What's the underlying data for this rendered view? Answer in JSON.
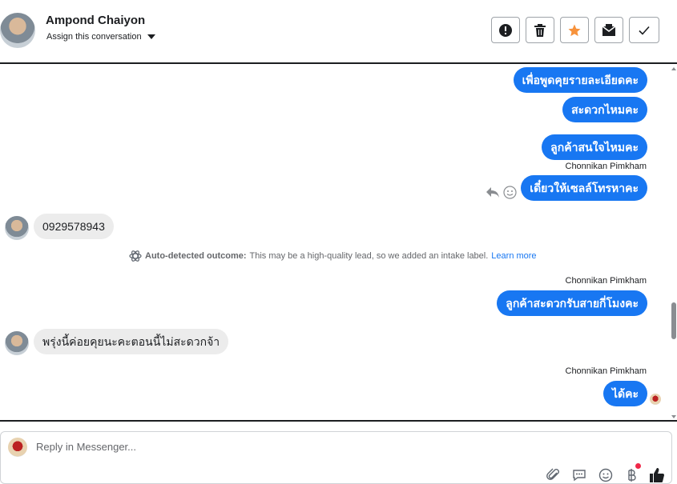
{
  "header": {
    "contact_name": "Ampond Chaiyon",
    "assign_label": "Assign this conversation",
    "actions": [
      "spam-icon",
      "trash-icon",
      "star-icon",
      "inbox-icon",
      "check-icon"
    ]
  },
  "messages": [
    {
      "dir": "out",
      "text": "เพื่อพูดคุยรายละเอียดคะ"
    },
    {
      "dir": "out",
      "text": "สะดวกไหมคะ"
    },
    {
      "dir": "out",
      "text": "ลูกค้าสนใจไหมคะ"
    },
    {
      "dir": "out",
      "sender": "Chonnikan Pimkham",
      "text": "เดี๋ยวให้เซลล์โทรหาคะ"
    },
    {
      "dir": "in",
      "text": "0929578943"
    },
    {
      "dir": "out",
      "sender": "Chonnikan Pimkham",
      "text": "ลูกค้าสะดวกรับสายกี่โมงคะ"
    },
    {
      "dir": "in",
      "text": "พรุ่งนี้ค่อยคุยนะคะตอนนี้ไม่สะดวกจ้า"
    },
    {
      "dir": "out",
      "sender": "Chonnikan Pimkham",
      "text": "ได้คะ"
    }
  ],
  "outcome": {
    "label": "Auto-detected outcome:",
    "text": "This may be a high-quality lead, so we added an intake label.",
    "link": "Learn more"
  },
  "composer": {
    "placeholder": "Reply in Messenger...",
    "tools": [
      "attach-icon",
      "saved-reply-icon",
      "emoji-icon",
      "payment-icon",
      "like-icon"
    ]
  },
  "colors": {
    "accent": "#1877f2",
    "incoming": "#ececec",
    "badge": "#f02849"
  }
}
